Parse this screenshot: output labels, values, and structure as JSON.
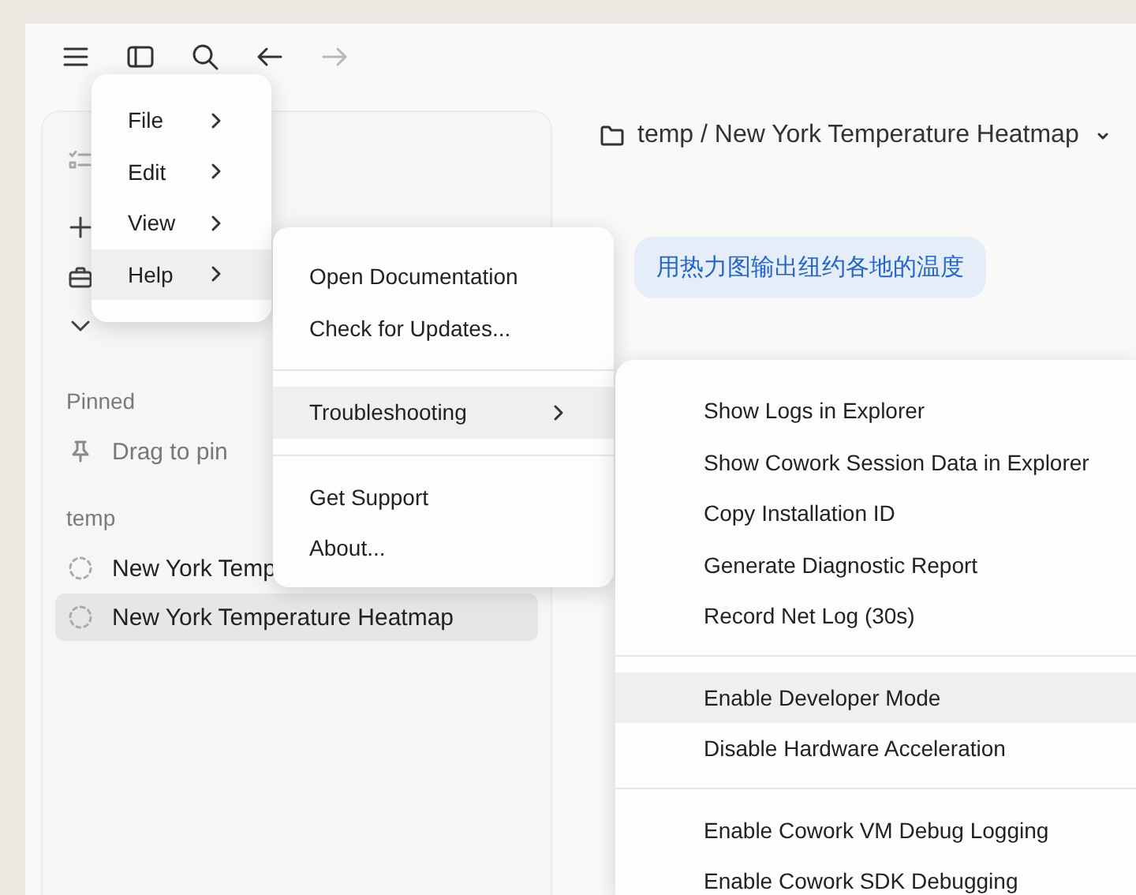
{
  "navigation": [
    {
      "kind": "menu",
      "disabled": false
    },
    {
      "kind": "sidebar",
      "disabled": false
    },
    {
      "kind": "search",
      "disabled": false
    },
    {
      "kind": "back",
      "disabled": false
    },
    {
      "kind": "forward",
      "disabled": true
    }
  ],
  "sidebar": {
    "items": [
      {
        "kind": "tasks"
      },
      {
        "kind": "new"
      },
      {
        "kind": "projects"
      },
      {
        "kind": "more"
      }
    ],
    "pinned": {
      "heading": "Pinned",
      "hint": "Drag to pin"
    },
    "groups": [
      {
        "heading": "temp",
        "items": [
          {
            "label": "New York Temp",
            "selected": false
          },
          {
            "label": "New York Temperature Heatmap",
            "selected": true
          }
        ]
      }
    ]
  },
  "breadcrumb": {
    "text": "temp / New York Temperature Heatmap"
  },
  "message": {
    "text": "用热力图输出纽约各地的温度"
  },
  "menus": [
    {
      "items": [
        {
          "kind": "item",
          "label": "File",
          "submenu": true,
          "selected": false
        },
        {
          "kind": "item",
          "label": "Edit",
          "submenu": true,
          "selected": false
        },
        {
          "kind": "item",
          "label": "View",
          "submenu": true,
          "selected": false
        },
        {
          "kind": "item",
          "label": "Help",
          "submenu": true,
          "selected": true
        }
      ]
    },
    {
      "items": [
        {
          "kind": "item",
          "label": "Open Documentation",
          "submenu": false,
          "selected": false
        },
        {
          "kind": "item",
          "label": "Check for Updates...",
          "submenu": false,
          "selected": false
        },
        {
          "kind": "separator"
        },
        {
          "kind": "item",
          "label": "Troubleshooting",
          "submenu": true,
          "selected": true
        },
        {
          "kind": "separator"
        },
        {
          "kind": "item",
          "label": "Get Support",
          "submenu": false,
          "selected": false
        },
        {
          "kind": "item",
          "label": "About...",
          "submenu": false,
          "selected": false
        }
      ]
    },
    {
      "items": [
        {
          "kind": "item",
          "label": "Show Logs in Explorer",
          "submenu": false,
          "selected": false
        },
        {
          "kind": "item",
          "label": "Show Cowork Session Data in Explorer",
          "submenu": false,
          "selected": false
        },
        {
          "kind": "item",
          "label": "Copy Installation ID",
          "submenu": false,
          "selected": false
        },
        {
          "kind": "item",
          "label": "Generate Diagnostic Report",
          "submenu": false,
          "selected": false
        },
        {
          "kind": "item",
          "label": "Record Net Log (30s)",
          "submenu": false,
          "selected": false
        },
        {
          "kind": "separator"
        },
        {
          "kind": "item",
          "label": "Enable Developer Mode",
          "submenu": false,
          "selected": true
        },
        {
          "kind": "item",
          "label": "Disable Hardware Acceleration",
          "submenu": false,
          "selected": false
        },
        {
          "kind": "separator"
        },
        {
          "kind": "item",
          "label": "Enable Cowork VM Debug Logging",
          "submenu": false,
          "selected": false
        },
        {
          "kind": "item",
          "label": "Enable Cowork SDK Debugging",
          "submenu": false,
          "selected": false
        }
      ]
    }
  ]
}
